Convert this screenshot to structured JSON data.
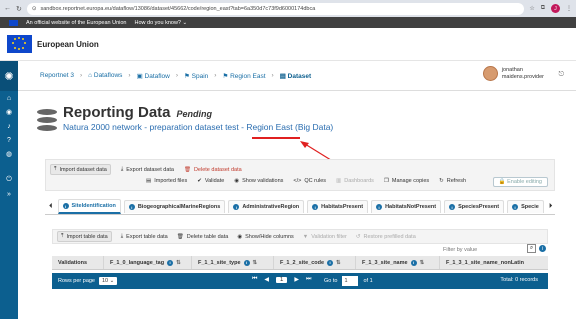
{
  "browser": {
    "url": "sandbox.reportnet.europa.eu/dataflow/13086/dataset/45662/code/region_east?tab=6a350d7c73f9d6000174dbca",
    "profile_letter": "J"
  },
  "official_banner": {
    "text": "An official website of the European Union",
    "how_text": "How do you know?"
  },
  "eu_header": {
    "title": "European Union"
  },
  "breadcrumbs": [
    {
      "label": "Reportnet 3"
    },
    {
      "label": "Dataflows"
    },
    {
      "label": "Dataflow"
    },
    {
      "label": "Spain"
    },
    {
      "label": "Region East"
    },
    {
      "label": "Dataset"
    }
  ],
  "user": {
    "name_line1": "jonathan",
    "name_line2": "maidens.provider"
  },
  "page": {
    "title": "Reporting Data",
    "status": "Pending",
    "subtitle": "Natura 2000 network - preparation dataset test - Region East (Big Data)"
  },
  "dataset_toolbar": {
    "row1": [
      {
        "label": "Import dataset data",
        "icon": "upload-icon"
      },
      {
        "label": "Export dataset data",
        "icon": "download-icon"
      },
      {
        "label": "Delete dataset data",
        "icon": "trash-icon"
      }
    ],
    "row2": [
      {
        "label": "Imported files",
        "icon": "file-icon"
      },
      {
        "label": "Validate",
        "icon": "check-icon"
      },
      {
        "label": "Show validations",
        "icon": "eye-icon"
      },
      {
        "label": "QC rules",
        "icon": "code-icon"
      },
      {
        "label": "Dashboards",
        "icon": "chart-icon"
      },
      {
        "label": "Manage copies",
        "icon": "copy-icon"
      },
      {
        "label": "Refresh",
        "icon": "refresh-icon"
      }
    ],
    "enable_editing": "Enable editing"
  },
  "tabs": [
    {
      "label": "SiteIdentification"
    },
    {
      "label": "BiogeographicalMarineRegions"
    },
    {
      "label": "AdministrativeRegion"
    },
    {
      "label": "HabitatsPresent"
    },
    {
      "label": "HabitatsNotPresent"
    },
    {
      "label": "SpeciesPresent"
    },
    {
      "label": "Specie"
    }
  ],
  "table_toolbar": [
    {
      "label": "Import table data",
      "icon": "upload-icon"
    },
    {
      "label": "Export table data",
      "icon": "download-icon"
    },
    {
      "label": "Delete table data",
      "icon": "trash-icon"
    },
    {
      "label": "Show/Hide columns",
      "icon": "eye-icon"
    },
    {
      "label": "Validation filter",
      "icon": "filter-icon"
    },
    {
      "label": "Restore prefilled data",
      "icon": "undo-icon"
    }
  ],
  "filter": {
    "label": "Filter by value"
  },
  "table": {
    "columns": [
      {
        "label": "Validations"
      },
      {
        "label": "F_1_0_language_tag"
      },
      {
        "label": "F_1_1_site_type"
      },
      {
        "label": "F_1_2_site_code"
      },
      {
        "label": "F_1_3_site_name"
      },
      {
        "label": "F_1_3_1_site_name_nonLatin"
      }
    ]
  },
  "paginator": {
    "rows_label": "Rows per page",
    "rows_value": "10",
    "page": "1",
    "goto_label": "Go to",
    "goto_value": "1",
    "of_label": "of 1",
    "total": "Total: 0 records"
  }
}
